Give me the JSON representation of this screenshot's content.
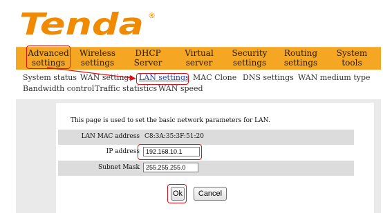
{
  "brand": {
    "logo_text": "Tenda",
    "registered_mark": "®",
    "color": "#f08a00"
  },
  "nav": {
    "items": [
      {
        "line1": "Advanced",
        "line2": "settings"
      },
      {
        "line1": "Wireless",
        "line2": "settings"
      },
      {
        "line1": "DHCP",
        "line2": "Server"
      },
      {
        "line1": "Virtual",
        "line2": "server"
      },
      {
        "line1": "Security",
        "line2": "settings"
      },
      {
        "line1": "Routing",
        "line2": "settings"
      },
      {
        "line1": "System",
        "line2": "tools"
      }
    ],
    "bar_color": "#f5a623"
  },
  "subnav": {
    "items": [
      "System status",
      "WAN settings",
      "LAN settings",
      "MAC Clone",
      "DNS settings",
      "WAN medium type",
      "Bandwidth control",
      "Traffic statistics",
      "WAN speed"
    ],
    "active": "LAN settings"
  },
  "page": {
    "intro": "This page is used to set the basic network parameters for LAN.",
    "mac_label": "LAN MAC address",
    "mac_value": "C8:3A:35:3F:51:20",
    "ip_label": "IP address",
    "ip_value": "192.168.10.1",
    "mask_label": "Subnet Mask",
    "mask_value": "255.255.255.0"
  },
  "buttons": {
    "ok": "Ok",
    "cancel": "Cancel"
  },
  "annotation_color": "#e0101a"
}
